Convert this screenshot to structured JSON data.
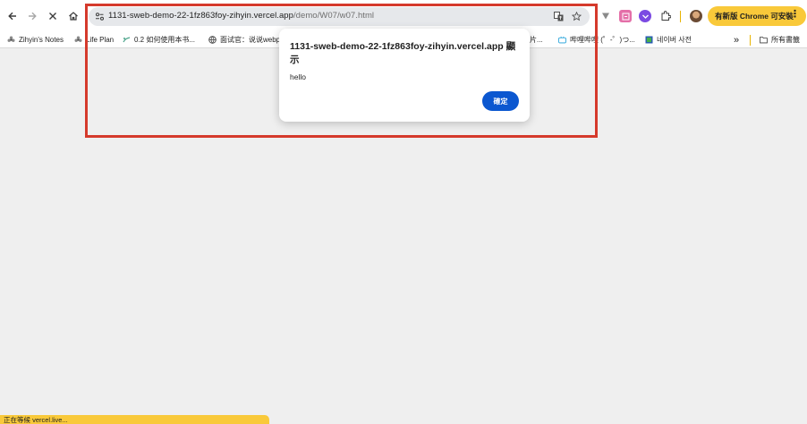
{
  "toolbar": {
    "url_host": "1131-sweb-demo-22-1fz863foy-zihyin.vercel.app",
    "url_path": "/demo/W07/w07.html",
    "update_button_label": "有新版 Chrome 可安裝",
    "icons": [
      "back-icon",
      "forward-icon",
      "stop-icon",
      "home-icon",
      "site-info-icon",
      "translate-icon",
      "star-icon",
      "extension-icon",
      "more-icon"
    ]
  },
  "bookmarks": {
    "items": [
      {
        "label": "Zihyin's Notes",
        "icon": "flower-icon"
      },
      {
        "label": "Life Plan",
        "icon": "flower-icon"
      },
      {
        "label": "0.2 如何使用本书...",
        "icon": "bookmark-icon"
      },
      {
        "label": "面试官：说说webp",
        "icon": "globe-icon"
      },
      {
        "label": "片...",
        "icon": "bookmark-icon"
      },
      {
        "label": "哔哩哔哩 (゜-゜)つ...",
        "icon": "bilibili-icon"
      },
      {
        "label": "네이버 사전",
        "icon": "naver-icon"
      }
    ],
    "overflow_label": "»",
    "all_bookmarks_label": "所有書籤"
  },
  "dialog": {
    "title": "1131-sweb-demo-22-1fz863foy-zihyin.vercel.app 顯示",
    "message": "hello",
    "ok_label": "確定"
  },
  "status_bar": {
    "text": "正在等候 vercel.live..."
  },
  "colors": {
    "accent": "#0b57d0",
    "highlight": "#d53a2c",
    "update_badge": "#f9c93a"
  }
}
